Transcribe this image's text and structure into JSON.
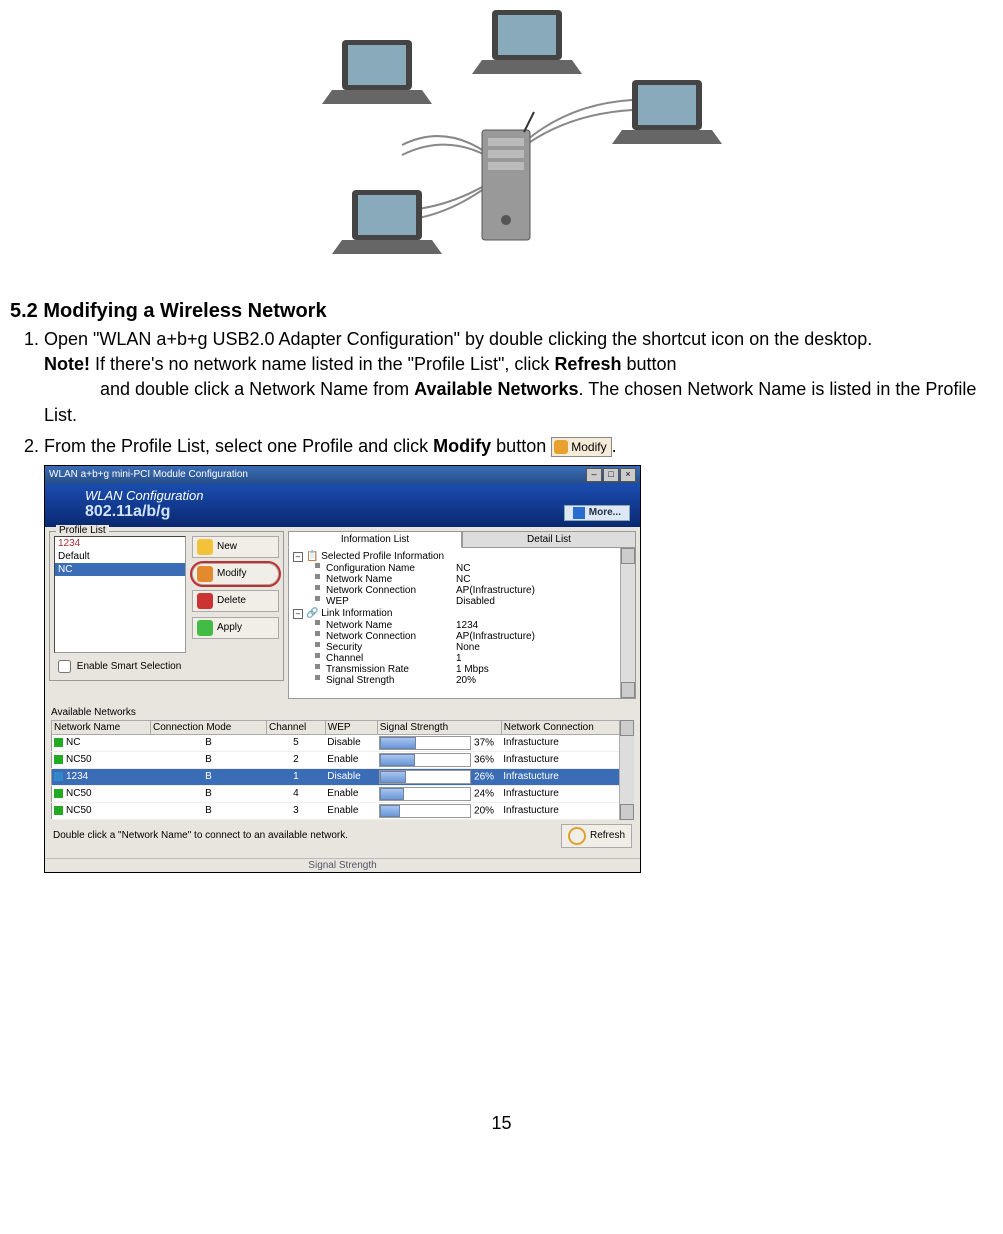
{
  "section_heading": "5.2 Modifying a Wireless Network",
  "steps": {
    "s1a": "Open \"WLAN a+b+g USB2.0 Adapter Configuration\" by double clicking the shortcut icon on the desktop.",
    "note_label": "Note!",
    "note_line1": "If there's no network name listed in the \"Profile List\", click ",
    "note_refresh": "Refresh",
    "note_line1b": " button",
    "note_line2a": "and double click a Network Name from ",
    "note_avail": "Available Networks",
    "note_line2b": ".   The chosen Network Name is listed in the Profile List.",
    "s2a": "From the Profile List, select one Profile and click ",
    "s2_modify": "Modify",
    "s2b": " button ",
    "s2c": "."
  },
  "inline_button": {
    "label": "Modify"
  },
  "screenshot": {
    "title": "WLAN a+b+g mini-PCI Module Configuration",
    "banner_line1": "WLAN Configuration",
    "banner_line2": "802.11a/b/g",
    "more": "More...",
    "profile_list_label": "Profile List",
    "profiles": [
      "1234",
      "Default",
      "NC"
    ],
    "buttons": {
      "new": "New",
      "modify": "Modify",
      "delete": "Delete",
      "apply": "Apply"
    },
    "smart_selection": "Enable Smart Selection",
    "tabs": {
      "info": "Information List",
      "detail": "Detail List"
    },
    "info_groups": {
      "g1_title": "Selected Profile Information",
      "g1": [
        {
          "k": "Configuration Name",
          "v": "NC"
        },
        {
          "k": "Network Name",
          "v": "NC"
        },
        {
          "k": "Network Connection",
          "v": "AP(Infrastructure)"
        },
        {
          "k": "WEP",
          "v": "Disabled"
        }
      ],
      "g2_title": "Link Information",
      "g2": [
        {
          "k": "Network Name",
          "v": "1234"
        },
        {
          "k": "Network Connection",
          "v": "AP(Infrastructure)"
        },
        {
          "k": "Security",
          "v": "None"
        },
        {
          "k": "Channel",
          "v": "1"
        },
        {
          "k": "Transmission Rate",
          "v": "1 Mbps"
        },
        {
          "k": "Signal Strength",
          "v": "20%"
        }
      ]
    },
    "avail_label": "Available Networks",
    "avail_cols": [
      "Network Name",
      "Connection Mode",
      "Channel",
      "WEP",
      "Signal Strength",
      "Network Connection"
    ],
    "avail_rows": [
      {
        "name": "NC",
        "mode": "B",
        "ch": "5",
        "wep": "Disable",
        "sig": "37%",
        "sigv": 37,
        "conn": "Infrastucture",
        "sel": false,
        "ic": "g"
      },
      {
        "name": "NC50",
        "mode": "B",
        "ch": "2",
        "wep": "Enable",
        "sig": "36%",
        "sigv": 36,
        "conn": "Infrastucture",
        "sel": false,
        "ic": "g"
      },
      {
        "name": "1234",
        "mode": "B",
        "ch": "1",
        "wep": "Disable",
        "sig": "26%",
        "sigv": 26,
        "conn": "Infrastucture",
        "sel": true,
        "ic": "b"
      },
      {
        "name": "NC50",
        "mode": "B",
        "ch": "4",
        "wep": "Enable",
        "sig": "24%",
        "sigv": 24,
        "conn": "Infrastucture",
        "sel": false,
        "ic": "g"
      },
      {
        "name": "NC50",
        "mode": "B",
        "ch": "3",
        "wep": "Enable",
        "sig": "20%",
        "sigv": 20,
        "conn": "Infrastucture",
        "sel": false,
        "ic": "g"
      }
    ],
    "footer_hint": "Double click a \"Network Name\" to connect to an available network.",
    "refresh": "Refresh",
    "sig_strength": "Signal Strength"
  },
  "page_number": "15"
}
